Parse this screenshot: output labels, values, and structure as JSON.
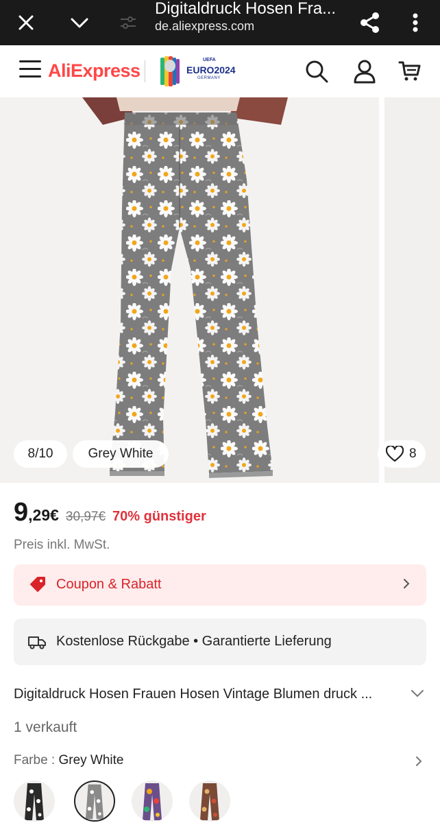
{
  "browser": {
    "title": "Digitaldruck Hosen Fra...",
    "url": "de.aliexpress.com",
    "icons": [
      "close-icon",
      "chevron-down-icon",
      "tune-icon",
      "share-icon",
      "more-vert-icon"
    ]
  },
  "header": {
    "logo_text": "AliExpress",
    "partner_logo_text": "EURO2024",
    "partner_logo_top": "UEFA",
    "partner_logo_sub": "GERMANY",
    "icons": [
      "menu-icon",
      "search-icon",
      "user-icon",
      "cart-icon"
    ]
  },
  "gallery": {
    "counter": "8/10",
    "color_tag": "Grey White",
    "wishlist_count": "8"
  },
  "price": {
    "integer": "9",
    "decimal": ",29€",
    "original": "30,97€",
    "discount": "70% günstiger",
    "tax_note": "Preis inkl. MwSt."
  },
  "coupon": {
    "label": "Coupon & Rabatt"
  },
  "benefits": {
    "text": "Kostenlose Rückgabe • Garantierte Lieferung"
  },
  "product": {
    "title": "Digitaldruck Hosen Frauen Hosen Vintage Blumen druck ...",
    "sold": "1 verkauft",
    "color_label": "Farbe : ",
    "color_value": "Grey White"
  },
  "swatches": [
    {
      "name": "black-white",
      "selected": false
    },
    {
      "name": "grey-white",
      "selected": true
    },
    {
      "name": "multicolor-floral",
      "selected": false
    },
    {
      "name": "brown-floral",
      "selected": false
    }
  ],
  "colors": {
    "brand_red": "#ff4747",
    "discount_red": "#e0323b",
    "coupon_bg": "#ffecec",
    "browser_bar": "#1a1a1a"
  }
}
